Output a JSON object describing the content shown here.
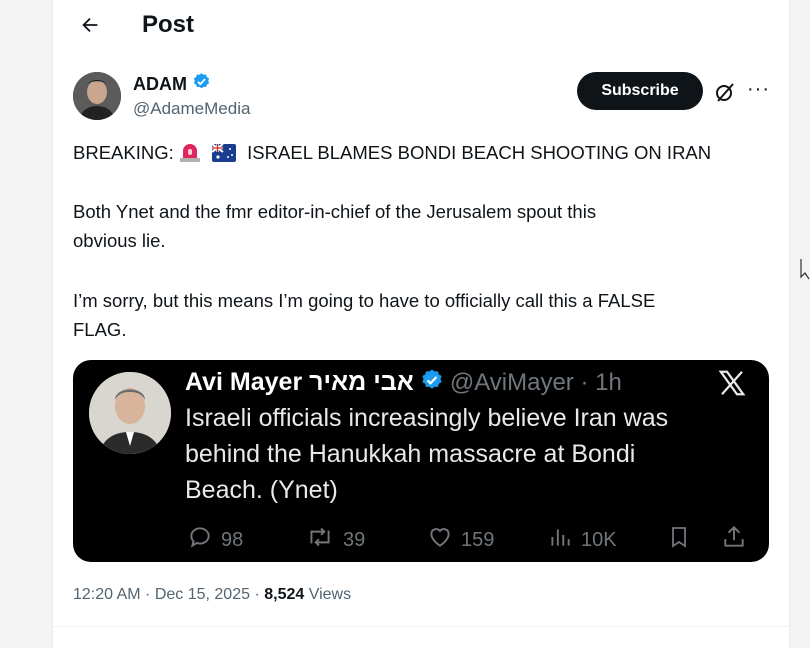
{
  "header": {
    "title": "Post"
  },
  "author": {
    "name": "ADAM",
    "handle": "@AdameMedia",
    "subscribe_label": "Subscribe",
    "more_label": "···"
  },
  "post": {
    "line1": "BREAKING:",
    "line1_rest": "ISRAEL BLAMES BONDI BEACH SHOOTING ON IRAN",
    "para2_line1": "Both Ynet and the fmr editor-in-chief of the Jerusalem spout this",
    "para2_line2": "obvious lie.",
    "para3_line1": "I’m sorry, but this means I’m going to have to officially call this a FALSE",
    "para3_line2": "FLAG."
  },
  "quote": {
    "name": "Avi Mayer אבי מאיר",
    "handle": "@AviMayer · 1h",
    "text_line1": "Israeli officials increasingly believe Iran was",
    "text_line2": "behind the Hanukkah massacre at Bondi",
    "text_line3": "Beach. (Ynet)",
    "replies": "98",
    "reposts": "39",
    "likes": "159",
    "views": "10K"
  },
  "meta": {
    "time": "12:20 AM · Dec 15, 2025 · ",
    "views_count": "8,524",
    "views_label": " Views"
  },
  "colors": {
    "verified": "#1d9bf0",
    "quote_bg": "#000000",
    "muted": "#536471"
  },
  "icons": [
    "back-arrow-icon",
    "verified-icon",
    "grok-icon",
    "more-icon",
    "siren-icon",
    "australia-flag-icon",
    "x-logo-icon",
    "reply-icon",
    "repost-icon",
    "like-icon",
    "views-icon",
    "bookmark-icon",
    "share-icon"
  ]
}
